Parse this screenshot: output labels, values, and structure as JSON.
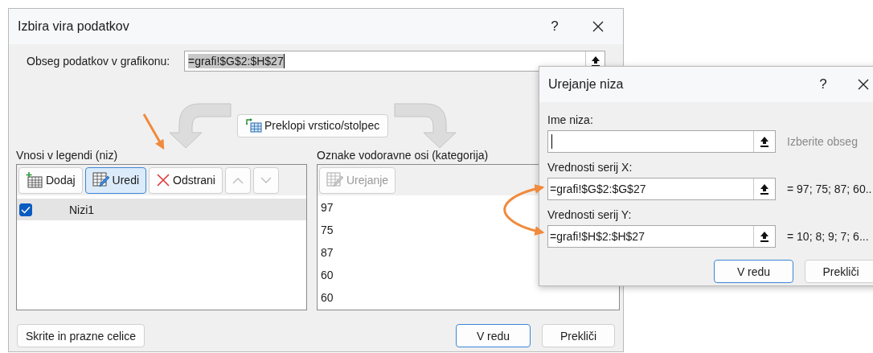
{
  "main_dialog": {
    "title": "Izbira vira podatkov",
    "help_button": "?",
    "range_label": "Obseg podatkov v grafikonu:",
    "range_value": "=grafi!$G$2:$H$27",
    "switch_button": "Preklopi vrstico/stolpec",
    "legend_label": "Vnosi v legendi (niz)",
    "legend_toolbar": [
      {
        "kind": "add",
        "label": "Dodaj",
        "selected": false,
        "disabled": false
      },
      {
        "kind": "edit",
        "label": "Uredi",
        "selected": true,
        "disabled": false
      },
      {
        "kind": "remove",
        "label": "Odstrani",
        "selected": false,
        "disabled": false
      },
      {
        "kind": "up",
        "selected": false,
        "disabled": true
      },
      {
        "kind": "down",
        "selected": false,
        "disabled": true
      }
    ],
    "series": [
      {
        "name": "Nizi1",
        "checked": true,
        "selected": true
      }
    ],
    "axis_label": "Oznake vodoravne osi (kategorija)",
    "axis_edit_button": {
      "label": "Urejanje",
      "disabled": true
    },
    "categories": [
      "97",
      "75",
      "87",
      "60",
      "60"
    ],
    "hidden_cells_button": "Skrite in prazne celice",
    "ok_button": "V redu",
    "cancel_button": "Prekliči"
  },
  "edit_series_dialog": {
    "title": "Urejanje niza",
    "help_button": "?",
    "fields": [
      {
        "kind": "hint",
        "label": "Ime niza:",
        "preview": "Izberite obseg"
      },
      {
        "kind": "value",
        "label": "Vrednosti serij X:",
        "value": "=grafi!$G$2:$G$27",
        "preview": "= 97; 75; 87; 60.."
      },
      {
        "kind": "value",
        "label": "Vrednosti serij Y:",
        "value": "=grafi!$H$2:$H$27",
        "preview": "= 10; 8; 9; 7; 6..."
      }
    ],
    "ok_button": "V redu",
    "cancel_button": "Prekliči"
  }
}
